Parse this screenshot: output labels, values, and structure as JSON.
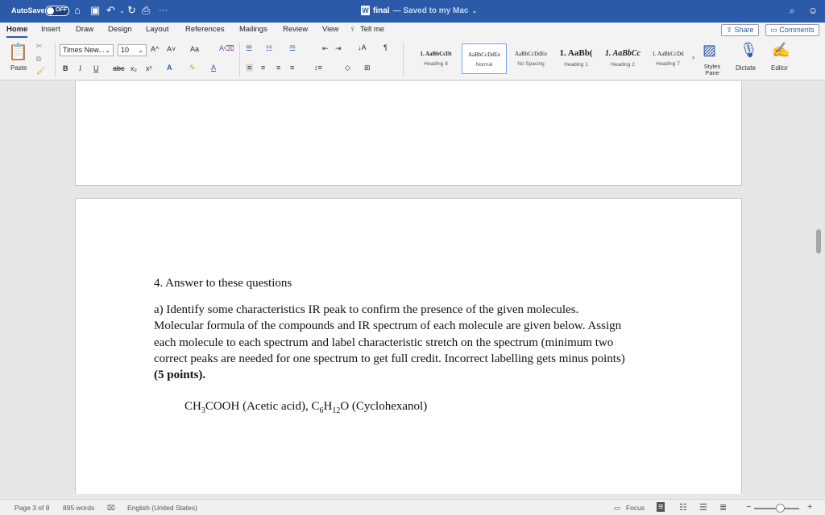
{
  "titlebar": {
    "autosave": "AutoSave",
    "autosave_state": "OFF",
    "title": "final",
    "saved": "— Saved to my Mac",
    "more": "···"
  },
  "tabs": [
    "Home",
    "Insert",
    "Draw",
    "Design",
    "Layout",
    "References",
    "Mailings",
    "Review",
    "View"
  ],
  "tell_me": "Tell me",
  "share": "Share",
  "comments": "Comments",
  "ribbon": {
    "paste": "Paste",
    "font": "Times New...",
    "size": "10",
    "case": "Aa",
    "bold": "B",
    "italic": "I",
    "underline": "U",
    "strike": "abc",
    "subscript": "x₂",
    "superscript": "x²",
    "grow": "A^",
    "shrink": "A˅",
    "styles_pane": "Styles Pane",
    "dictate": "Dictate",
    "editor": "Editor"
  },
  "styles": [
    {
      "sample": "1. AaBbCcDt",
      "name": "Heading 8",
      "kind": "small"
    },
    {
      "sample": "AaBbCcDdEe",
      "name": "Normal",
      "kind": "small"
    },
    {
      "sample": "AaBbCcDdEe",
      "name": "No Spacing",
      "kind": "small"
    },
    {
      "sample": "1. AaBb(",
      "name": "Heading 1",
      "kind": "big"
    },
    {
      "sample": "1. AaBbCc",
      "name": "Heading 2",
      "kind": "bigi"
    },
    {
      "sample": "1. AaBbCcDd",
      "name": "Heading 7",
      "kind": "small"
    }
  ],
  "document": {
    "heading": "4. Answer to these questions",
    "para_lines": [
      "a) Identify some characteristics IR peak to confirm the presence of the given molecules.",
      "Molecular formula of the compounds and IR spectrum of each molecule are given below. Assign",
      "each molecule to each spectrum and label characteristic stretch on the spectrum (minimum two",
      "correct peaks are needed for one spectrum to get full credit. Incorrect labelling gets minus points)"
    ],
    "points": "(5 points).",
    "formula": {
      "a1": "CH",
      "a1s": "3",
      "a2": "COOH (Acetic acid), C",
      "a2s": "6",
      "a3": "H",
      "a3s": "12",
      "a4": "O (Cyclohexanol)"
    }
  },
  "statusbar": {
    "page": "Page 3 of 8",
    "words": "895 words",
    "language": "English (United States)",
    "focus": "Focus",
    "zoom_minus": "−",
    "zoom_plus": "+"
  }
}
